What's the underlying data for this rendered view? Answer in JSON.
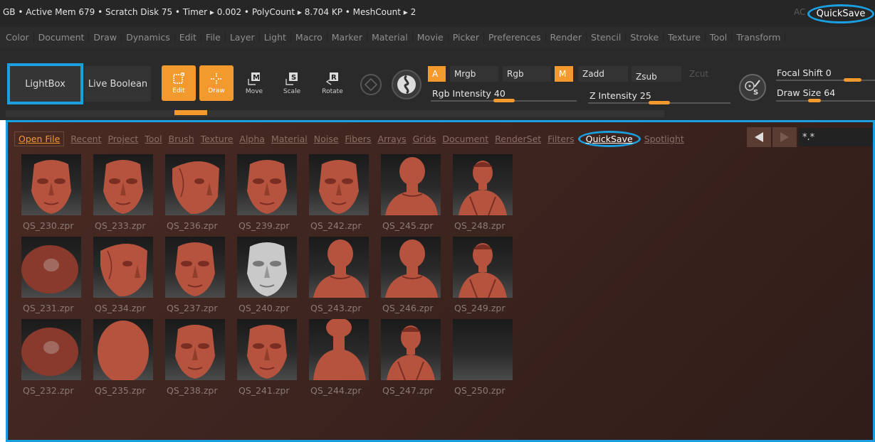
{
  "title_bar": {
    "status": "GB • Active Mem 679 • Scratch Disk 75 •  Timer ▸ 0.002 • PolyCount ▸ 8.704 KP  • MeshCount ▸ 2",
    "ac": "AC",
    "quicksave": "QuickSave"
  },
  "menu": [
    "Color",
    "Document",
    "Draw",
    "Dynamics",
    "Edit",
    "File",
    "Layer",
    "Light",
    "Macro",
    "Marker",
    "Material",
    "Movie",
    "Picker",
    "Preferences",
    "Render",
    "Stencil",
    "Stroke",
    "Texture",
    "Tool",
    "Transform"
  ],
  "toolbar": {
    "lightbox": "LightBox",
    "live_boolean": "Live Boolean",
    "edit": "Edit",
    "draw": "Draw",
    "move": "Move",
    "scale": "Scale",
    "rotate": "Rotate",
    "a_label": "A",
    "mrgb": "Mrgb",
    "rgb": "Rgb",
    "m_label": "M",
    "zadd": "Zadd",
    "zsub": "Zsub",
    "zcut": "Zcut",
    "rgb_intensity": "Rgb Intensity 40",
    "z_intensity": "Z Intensity 25",
    "focal_shift": "Focal Shift 0",
    "draw_size": "Draw Size 64",
    "rgb_intensity_value": 40,
    "z_intensity_value": 25
  },
  "lightbox": {
    "tabs": [
      "Open File",
      "Recent",
      "Project",
      "Tool",
      "Brush",
      "Texture",
      "Alpha",
      "Material",
      "Noise",
      "Fibers",
      "Arrays",
      "Grids",
      "Document",
      "RenderSet",
      "Filters",
      "QuickSave",
      "Spotlight"
    ],
    "filter": "*.*",
    "files": [
      {
        "name": "QS_230.zpr",
        "kind": "face"
      },
      {
        "name": "QS_233.zpr",
        "kind": "face"
      },
      {
        "name": "QS_236.zpr",
        "kind": "face-side"
      },
      {
        "name": "QS_239.zpr",
        "kind": "face"
      },
      {
        "name": "QS_242.zpr",
        "kind": "face"
      },
      {
        "name": "QS_245.zpr",
        "kind": "bust-back"
      },
      {
        "name": "QS_248.zpr",
        "kind": "bust"
      },
      {
        "name": "QS_231.zpr",
        "kind": "blob"
      },
      {
        "name": "QS_234.zpr",
        "kind": "face-side"
      },
      {
        "name": "QS_237.zpr",
        "kind": "face"
      },
      {
        "name": "QS_240.zpr",
        "kind": "face-grey"
      },
      {
        "name": "QS_243.zpr",
        "kind": "bust-back"
      },
      {
        "name": "QS_246.zpr",
        "kind": "bust-back"
      },
      {
        "name": "QS_249.zpr",
        "kind": "bust"
      },
      {
        "name": "QS_232.zpr",
        "kind": "blob"
      },
      {
        "name": "QS_235.zpr",
        "kind": "egg"
      },
      {
        "name": "QS_238.zpr",
        "kind": "face"
      },
      {
        "name": "QS_241.zpr",
        "kind": "face"
      },
      {
        "name": "QS_244.zpr",
        "kind": "bust-neck"
      },
      {
        "name": "QS_247.zpr",
        "kind": "bust"
      },
      {
        "name": "QS_250.zpr",
        "kind": "empty"
      }
    ]
  },
  "colors": {
    "accent": "#f39a2f",
    "highlight": "#1a9fe0",
    "clay": "#b5533e"
  }
}
